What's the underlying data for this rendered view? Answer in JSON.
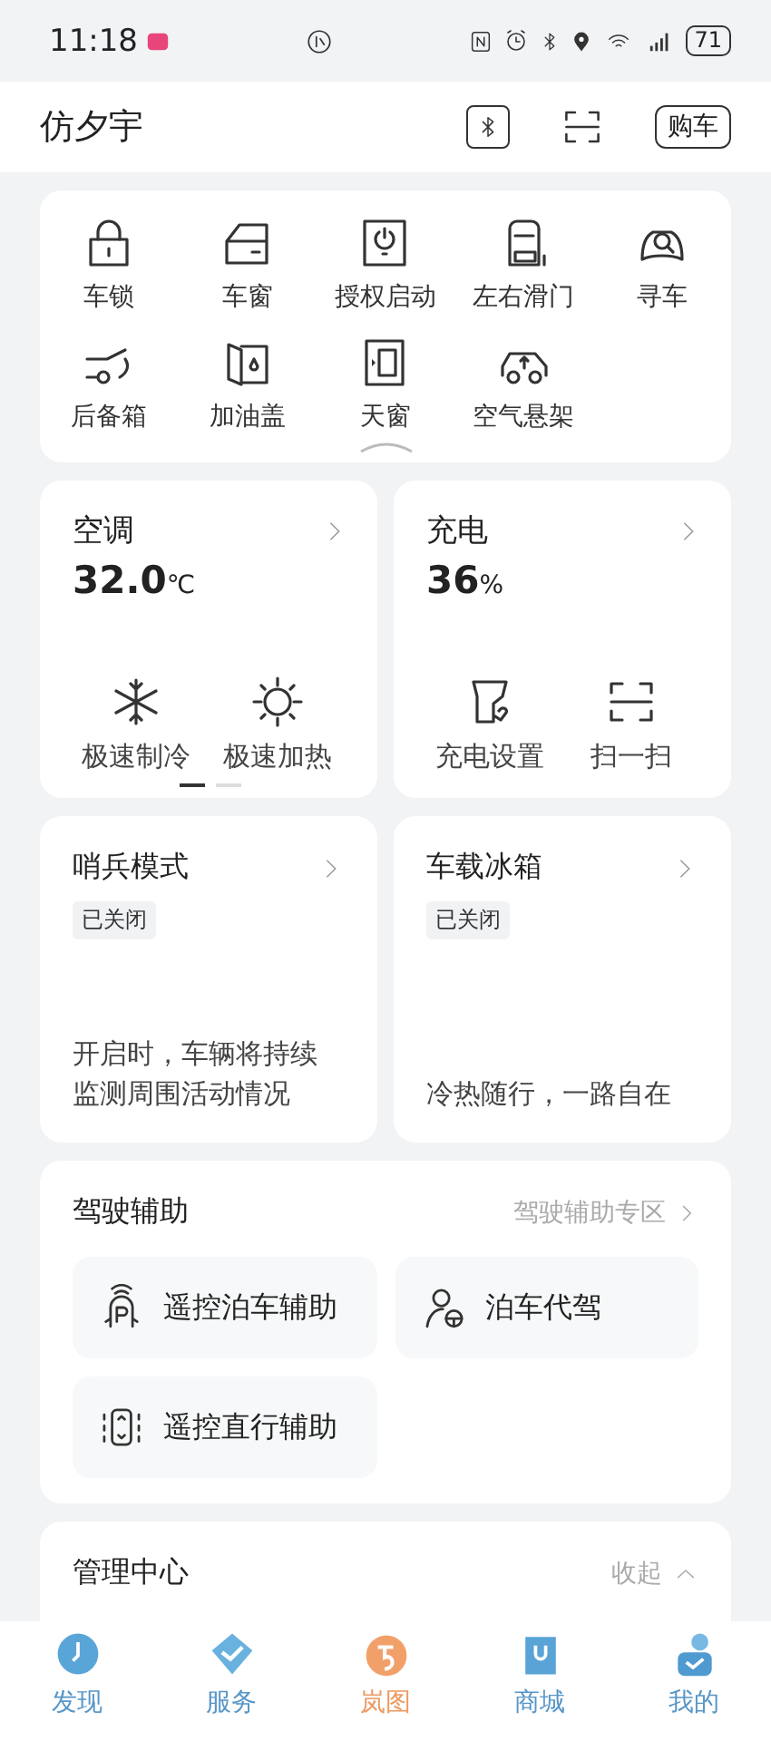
{
  "status_bar": {
    "time": "11:18",
    "battery": "71"
  },
  "header": {
    "title": "仿夕宇",
    "buy_button": "购车"
  },
  "quick_controls": [
    {
      "label": "车锁"
    },
    {
      "label": "车窗"
    },
    {
      "label": "授权启动"
    },
    {
      "label": "左右滑门"
    },
    {
      "label": "寻车"
    },
    {
      "label": "后备箱"
    },
    {
      "label": "加油盖"
    },
    {
      "label": "天窗"
    },
    {
      "label": "空气悬架"
    }
  ],
  "climate": {
    "title": "空调",
    "value": "32.0",
    "unit": "℃",
    "actions": [
      {
        "label": "极速制冷"
      },
      {
        "label": "极速加热"
      }
    ],
    "page_indicator": [
      {
        "selected": true
      },
      {
        "selected": false
      }
    ]
  },
  "charging": {
    "title": "充电",
    "value": "36",
    "unit": "%",
    "actions": [
      {
        "label": "充电设置"
      },
      {
        "label": "扫一扫"
      }
    ]
  },
  "sentry": {
    "title": "哨兵模式",
    "status": "已关闭",
    "description": "开启时，车辆将持续监测周围活动情况"
  },
  "fridge": {
    "title": "车载冰箱",
    "status": "已关闭",
    "description": "冷热随行，一路自在"
  },
  "driving_assist": {
    "title": "驾驶辅助",
    "link": "驾驶辅助专区",
    "items": [
      {
        "label": "遥控泊车辅助"
      },
      {
        "label": "泊车代驾"
      },
      {
        "label": "遥控直行辅助"
      }
    ]
  },
  "management": {
    "title": "管理中心",
    "toggle": "收起"
  },
  "tabs": [
    {
      "label": "发现",
      "selected": false
    },
    {
      "label": "服务",
      "selected": false
    },
    {
      "label": "岚图",
      "selected": true
    },
    {
      "label": "商城",
      "selected": false
    },
    {
      "label": "我的",
      "selected": false
    }
  ]
}
